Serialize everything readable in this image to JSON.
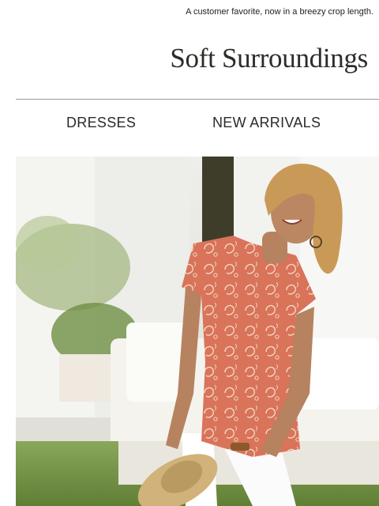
{
  "preheader": {
    "text": "A customer favorite, now in a breezy crop length."
  },
  "brand": {
    "name": "Soft Surroundings"
  },
  "nav": {
    "items": [
      {
        "label": "DRESSES"
      },
      {
        "label": "NEW ARRIVALS"
      }
    ]
  },
  "hero": {
    "image_description_icon": "hero-photo-model-coral-paisley-top",
    "colors": {
      "top": "#d9735a",
      "pants": "#ffffff",
      "grass": "#6d8f3f"
    }
  }
}
